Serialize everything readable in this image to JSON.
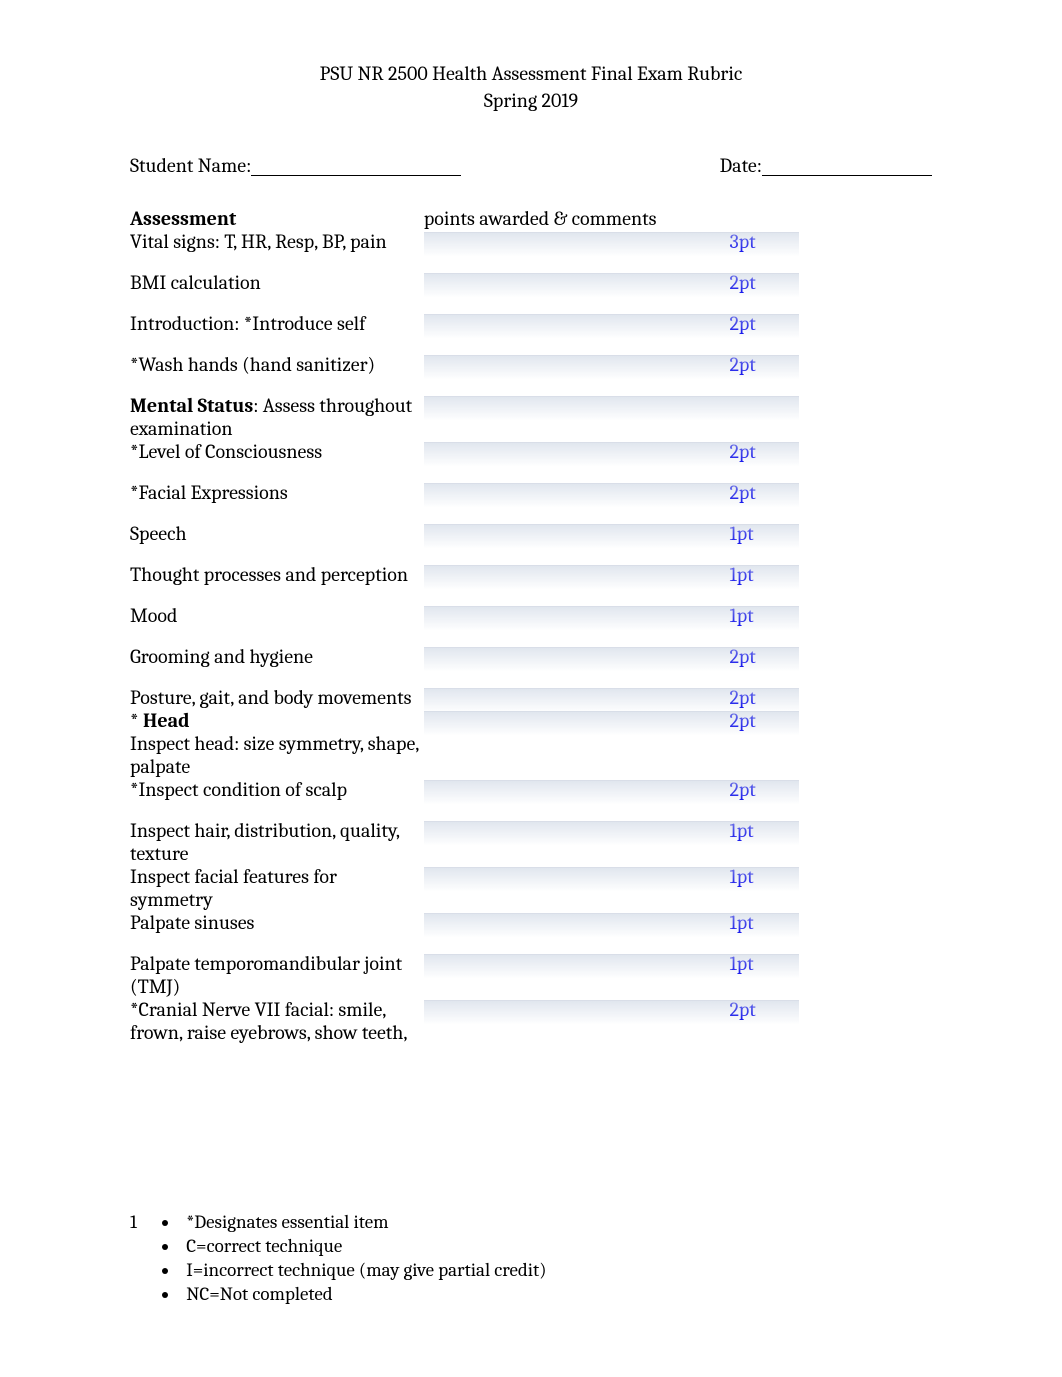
{
  "header": {
    "title_line1": "PSU NR 2500 Health Assessment Final Exam Rubric",
    "title_line2": "Spring 2019"
  },
  "fields": {
    "student_name_label": "Student Name:",
    "date_label": "Date:"
  },
  "columns": {
    "assessment": "Assessment",
    "points_comments": "points awarded & comments"
  },
  "rows": [
    {
      "label": "Vital signs:  T, HR, Resp, BP, pain",
      "points": "3pt"
    },
    {
      "gap": true
    },
    {
      "label": "BMI calculation",
      "points": "2pt"
    },
    {
      "gap": true
    },
    {
      "label": "Introduction: *Introduce self",
      "points": "2pt"
    },
    {
      "gap": true
    },
    {
      "label": "*Wash hands (hand sanitizer)",
      "points": "2pt"
    },
    {
      "gap": true
    },
    {
      "label_html": "<span class='bold'>Mental Status</span>: Assess throughout examination",
      "points": ""
    },
    {
      "label": "*Level of Consciousness",
      "points": "2pt"
    },
    {
      "gap": true
    },
    {
      "label": "*Facial Expressions",
      "points": "2pt"
    },
    {
      "gap": true
    },
    {
      "label": "Speech",
      "points": "1pt"
    },
    {
      "gap": true
    },
    {
      "label": "Thought processes and perception",
      "points": "1pt"
    },
    {
      "gap": true
    },
    {
      "label": "Mood",
      "points": "1pt"
    },
    {
      "gap": true
    },
    {
      "label": "Grooming and hygiene",
      "points": "2pt"
    },
    {
      "gap": true
    },
    {
      "label": "Posture, gait, and body movements",
      "points": "2pt"
    },
    {
      "label_html": "* <span class='bold'>Head</span><br>Inspect head: size symmetry, shape, palpate",
      "points": "2pt"
    },
    {
      "label": "*Inspect condition of scalp",
      "points": "2pt"
    },
    {
      "gap": true
    },
    {
      "label": "Inspect hair, distribution, quality, texture",
      "points": "1pt"
    },
    {
      "label": "Inspect facial features for symmetry",
      "points": "1pt"
    },
    {
      "label": "Palpate sinuses",
      "points": "1pt"
    },
    {
      "gap": true
    },
    {
      "label": "Palpate temporomandibular joint (TMJ)",
      "points": "1pt"
    },
    {
      "label": "*Cranial Nerve VII facial: smile, frown, raise eyebrows, show teeth,",
      "points": "2pt"
    }
  ],
  "footer": {
    "page_number": "1",
    "legend": [
      "*Designates essential item",
      "C=correct technique",
      "I=incorrect technique (may give partial credit)",
      "NC=Not completed"
    ]
  }
}
